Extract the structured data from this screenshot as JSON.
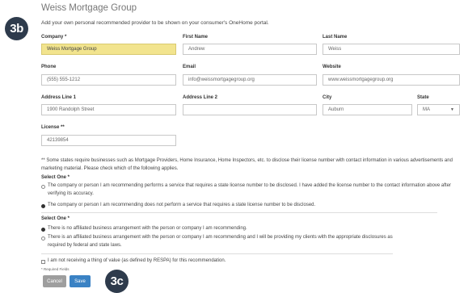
{
  "header": {
    "title": "Weiss Mortgage Group",
    "subtitle": "Add your own personal recommended provider to be shown on your consumer's OneHome portal."
  },
  "callouts": {
    "top": "3b",
    "bottom": "3c"
  },
  "form": {
    "company": {
      "label": "Company *",
      "value": "Weiss Mortgage Group"
    },
    "first_name": {
      "label": "First Name",
      "value": "Andrew"
    },
    "last_name": {
      "label": "Last Name",
      "value": "Weiss"
    },
    "phone": {
      "label": "Phone",
      "value": "(555) 555-1212"
    },
    "email": {
      "label": "Email",
      "value": "info@weissmortgagegroup.org"
    },
    "website": {
      "label": "Website",
      "value": "www.weissmortgagegroup.org"
    },
    "address1": {
      "label": "Address Line 1",
      "value": "1900 Randolph Street"
    },
    "address2": {
      "label": "Address Line 2",
      "value": ""
    },
    "city": {
      "label": "City",
      "value": "Auburn"
    },
    "state": {
      "label": "State",
      "value": "MA"
    },
    "license": {
      "label": "License **",
      "value": "42139854"
    }
  },
  "license_note": "** Some states require businesses such as Mortgage Providers, Home Insurance, Home Inspectors, etc. to disclose their license number with contact information in various advertisements and marketing material. Please check which of the following applies.",
  "select_one_1": {
    "label": "Select One *",
    "options": [
      {
        "text": "The company or person I am recommending performs a service that requires a state license number to be disclosed. I have added the license number to the contact information above after verifying its accuracy.",
        "selected": false
      },
      {
        "text": "The company or person I am recommending does not perform a service that requires a state license number to be disclosed.",
        "selected": true
      }
    ]
  },
  "select_one_2": {
    "label": "Select One *",
    "options": [
      {
        "text": "There is no affiliated business arrangement with the person or company I am recommending.",
        "selected": true
      },
      {
        "text": "There is an affiliated business arrangement with the person or company I am recommending and I will be providing my clients with the appropriate disclosures as required by federal and state laws.",
        "selected": false
      }
    ]
  },
  "respa_checkbox": {
    "text": "I am not receiving a thing of value (as defined by RESPA) for this recommendation.",
    "checked": false
  },
  "required_note": "* Required Fields",
  "buttons": {
    "cancel": "Cancel",
    "save": "Save"
  },
  "colors": {
    "highlight": "#f2e48e",
    "callout": "#2e3b4c",
    "save": "#3a82c4",
    "cancel": "#9e9e9e"
  }
}
